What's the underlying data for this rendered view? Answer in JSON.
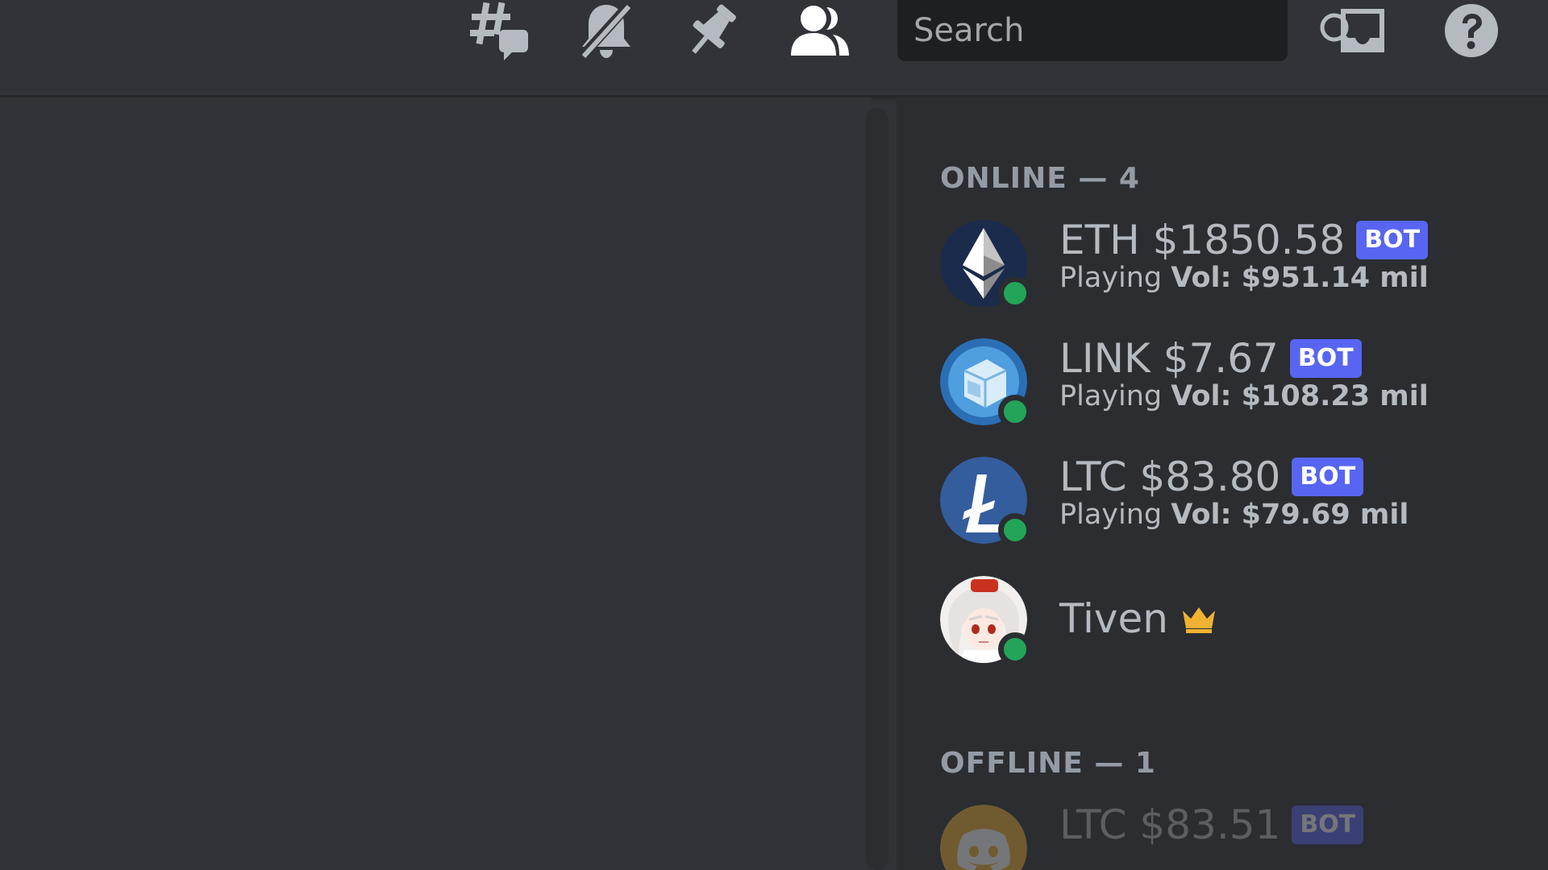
{
  "header": {
    "threads_icon": "threads-icon",
    "notifications_icon": "bell-muted-icon",
    "pins_icon": "pin-icon",
    "members_icon": "members-icon",
    "search_placeholder": "Search",
    "inbox_icon": "inbox-icon",
    "help_icon": "help-icon"
  },
  "members": {
    "online_heading": "ONLINE — 4",
    "offline_heading": "OFFLINE — 1",
    "online": [
      {
        "name": "ETH $1850.58",
        "bot_tag": "BOT",
        "activity_prefix": "Playing",
        "activity": "Vol: $951.14 mil",
        "avatar_icon": "ethereum-logo-icon",
        "status": "online"
      },
      {
        "name": "LINK $7.67",
        "bot_tag": "BOT",
        "activity_prefix": "Playing",
        "activity": "Vol: $108.23 mil",
        "avatar_icon": "chainlink-logo-icon",
        "status": "online"
      },
      {
        "name": "LTC $83.80",
        "bot_tag": "BOT",
        "activity_prefix": "Playing",
        "activity": "Vol: $79.69 mil",
        "avatar_icon": "litecoin-logo-icon",
        "status": "online"
      },
      {
        "name": "Tiven",
        "avatar_icon": "anime-avatar-icon",
        "status": "online",
        "owner_icon": "crown-icon"
      }
    ],
    "offline": [
      {
        "name": "LTC $83.51",
        "bot_tag": "BOT",
        "avatar_icon": "discord-default-avatar-icon",
        "status": "offline"
      }
    ]
  },
  "colors": {
    "background": "#313338",
    "member_list_bg": "#2b2d31",
    "online_status": "#23a559",
    "bot_tag": "#5865f2",
    "crown": "#f0b232"
  }
}
